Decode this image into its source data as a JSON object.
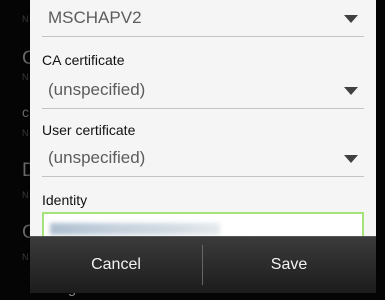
{
  "background_list": {
    "letters": [
      "C",
      "c",
      "D",
      "G"
    ],
    "small_letters": [
      "N",
      "N",
      "N",
      "N",
      "N",
      "N"
    ],
    "bottom_item": "Margherita"
  },
  "dialog": {
    "eap_method": {
      "value": "MSCHAPV2"
    },
    "ca_certificate": {
      "label": "CA certificate",
      "value": "(unspecified)"
    },
    "user_certificate": {
      "label": "User certificate",
      "value": "(unspecified)"
    },
    "identity": {
      "label": "Identity"
    },
    "buttons": {
      "cancel": "Cancel",
      "save": "Save"
    }
  },
  "colors": {
    "input_focus_border": "#a6e27a",
    "button_bar": "#2b2b2b"
  }
}
